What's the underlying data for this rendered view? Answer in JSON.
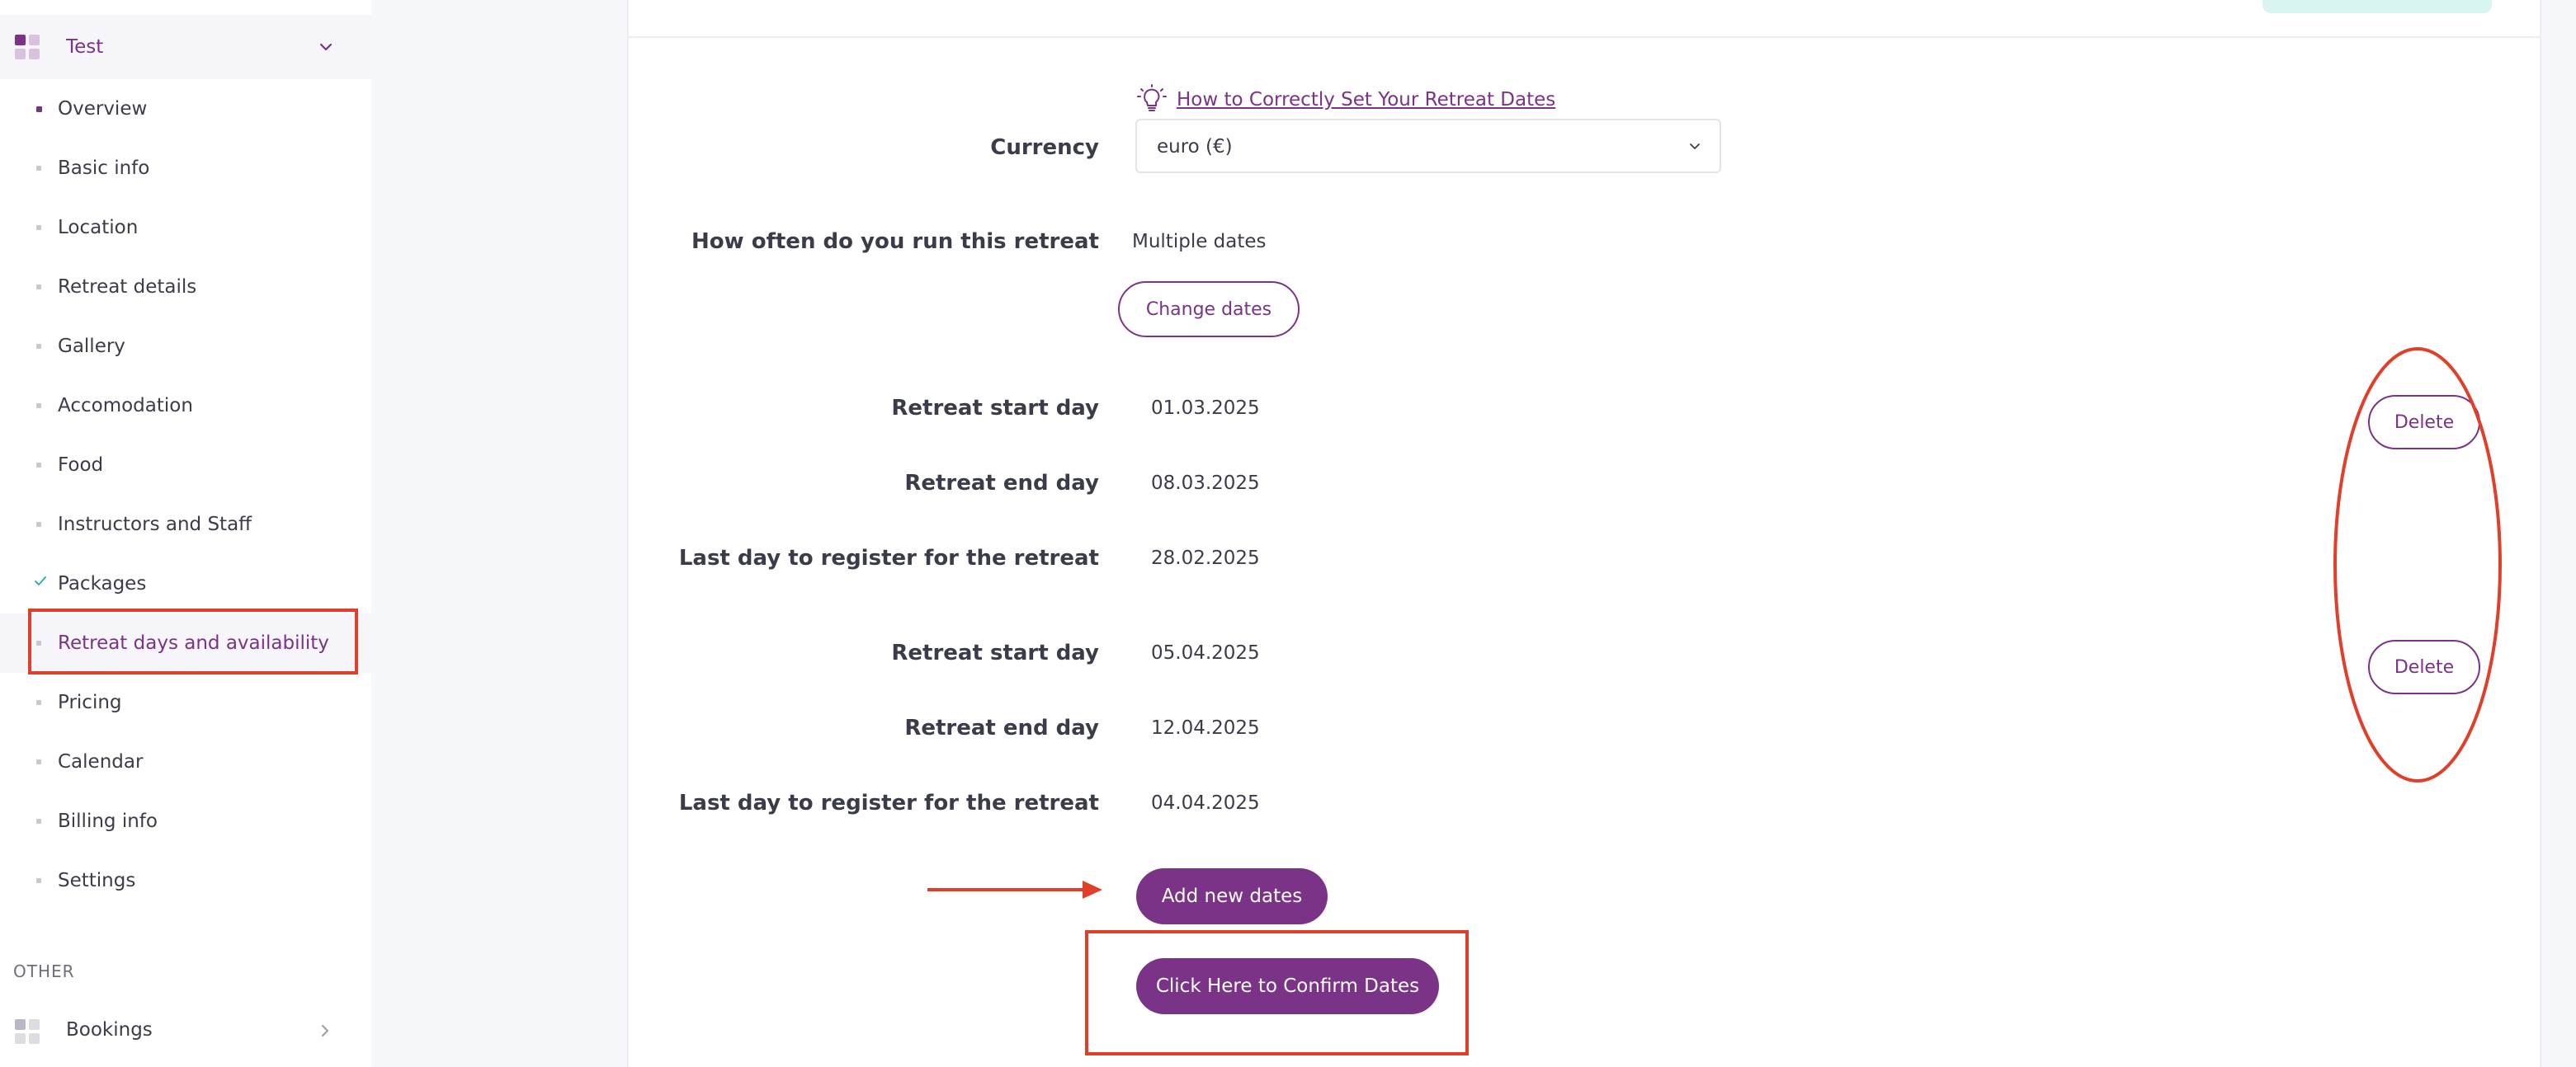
{
  "sidebar": {
    "group": {
      "label": "Test",
      "icon": "grid-icon",
      "chevron": "chevron-down-icon"
    },
    "items": [
      {
        "label": "Overview",
        "marker": "bullet-dark"
      },
      {
        "label": "Basic info",
        "marker": "bullet"
      },
      {
        "label": "Location",
        "marker": "bullet"
      },
      {
        "label": "Retreat details",
        "marker": "bullet"
      },
      {
        "label": "Gallery",
        "marker": "bullet"
      },
      {
        "label": "Accomodation",
        "marker": "bullet"
      },
      {
        "label": "Food",
        "marker": "bullet"
      },
      {
        "label": "Instructors and Staff",
        "marker": "bullet"
      },
      {
        "label": "Packages",
        "marker": "check-icon"
      },
      {
        "label": "Retreat days and availability",
        "marker": "bullet",
        "active": true
      },
      {
        "label": "Pricing",
        "marker": "bullet"
      },
      {
        "label": "Calendar",
        "marker": "bullet"
      },
      {
        "label": "Billing info",
        "marker": "bullet"
      },
      {
        "label": "Settings",
        "marker": "bullet"
      }
    ],
    "other_section": {
      "title": "OTHER",
      "bookings_label": "Bookings"
    }
  },
  "main": {
    "help_link": "How to Correctly Set Your Retreat Dates",
    "currency": {
      "label": "Currency",
      "value": "euro (€)"
    },
    "frequency": {
      "label": "How often do you run this retreat",
      "value": "Multiple dates"
    },
    "change_dates_label": "Change dates",
    "date_sets": [
      {
        "start_label": "Retreat start day",
        "start": "01.03.2025",
        "end_label": "Retreat end day",
        "end": "08.03.2025",
        "register_label": "Last day to register for the retreat",
        "register": "28.02.2025",
        "delete_label": "Delete"
      },
      {
        "start_label": "Retreat start day",
        "start": "05.04.2025",
        "end_label": "Retreat end day",
        "end": "12.04.2025",
        "register_label": "Last day to register for the retreat",
        "register": "04.04.2025",
        "delete_label": "Delete"
      }
    ],
    "add_dates_label": "Add new dates",
    "confirm_label": "Click Here to Confirm Dates"
  },
  "colors": {
    "accent": "#7a3386",
    "annotation": "#e0402a",
    "sidebar_active_bg": "#f6f5fa",
    "teal": "#d9f5f1"
  }
}
